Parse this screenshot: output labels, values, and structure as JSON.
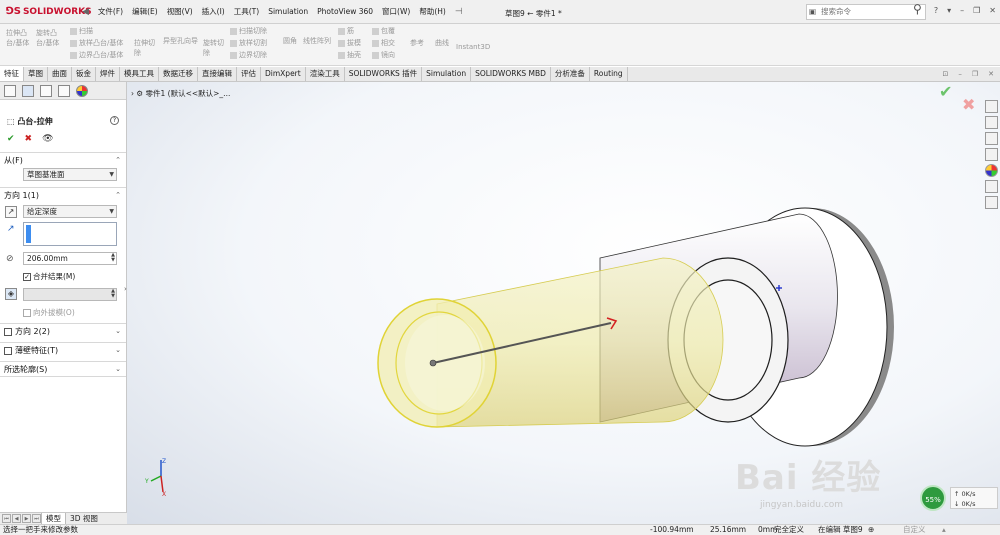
{
  "app": {
    "logo": "SOLIDWORKS",
    "doc_title": "草图9 ← 零件1 *"
  },
  "menu": [
    "文件(F)",
    "编辑(E)",
    "视图(V)",
    "插入(I)",
    "工具(T)",
    "Simulation",
    "PhotoView 360",
    "窗口(W)",
    "帮助(H)"
  ],
  "search": {
    "placeholder": "搜索命令"
  },
  "commands": {
    "extrude_boss": "拉伸凸\n台/基体",
    "revolve_boss": "旋转凸\n台/基体",
    "sweep": "扫描",
    "loft_boss": "放样凸台/基体",
    "boundary_boss": "边界凸台/基体",
    "extrude_cut": "拉伸切\n除",
    "hole_wizard": "异型孔向导",
    "revolve_cut": "旋转切\n除",
    "sweep_cut": "扫描切除",
    "loft_cut": "放样切割",
    "boundary_cut": "边界切除",
    "fillet": "圆角",
    "linear_pattern": "线性阵列",
    "rib": "筋",
    "draft": "拔模",
    "shell": "抽壳",
    "wrap": "包覆",
    "intersect": "相交",
    "mirror": "镜向",
    "reference": "参考",
    "curves": "曲线",
    "instant3d": "Instant3D"
  },
  "tabs": [
    "特征",
    "草图",
    "曲面",
    "钣金",
    "焊件",
    "模具工具",
    "数据迁移",
    "直接编辑",
    "评估",
    "DimXpert",
    "渲染工具",
    "SOLIDWORKS 插件",
    "Simulation",
    "SOLIDWORKS MBD",
    "分析准备",
    "Routing"
  ],
  "feature": {
    "title": "凸台-拉伸",
    "help": "?",
    "from_label": "从(F)",
    "from_value": "草图基准面",
    "dir1_label": "方向 1(1)",
    "dir1_type": "给定深度",
    "depth": "206.00mm",
    "merge_result": "合并结果(M)",
    "draft_outward": "向外拔模(O)",
    "dir2_label": "方向 2(2)",
    "thin_feature": "薄壁特征(T)",
    "contours": "所选轮廓(S)"
  },
  "tree_crumb": "零件1  (默认<<默认>_...",
  "bottom_tabs": [
    "模型",
    "3D 视图"
  ],
  "status": {
    "hint": "选择一把手来修改参数",
    "x": "-100.94mm",
    "y": "25.16mm",
    "z": "0mm",
    "defined": "完全定义",
    "editing": "在编辑 草图9",
    "custom": "自定义"
  },
  "watermark": {
    "main": "Bai 经验",
    "url": "jingyan.baidu.com"
  },
  "net": {
    "percent": "55%",
    "up": "0K/s",
    "down": "0K/s"
  }
}
